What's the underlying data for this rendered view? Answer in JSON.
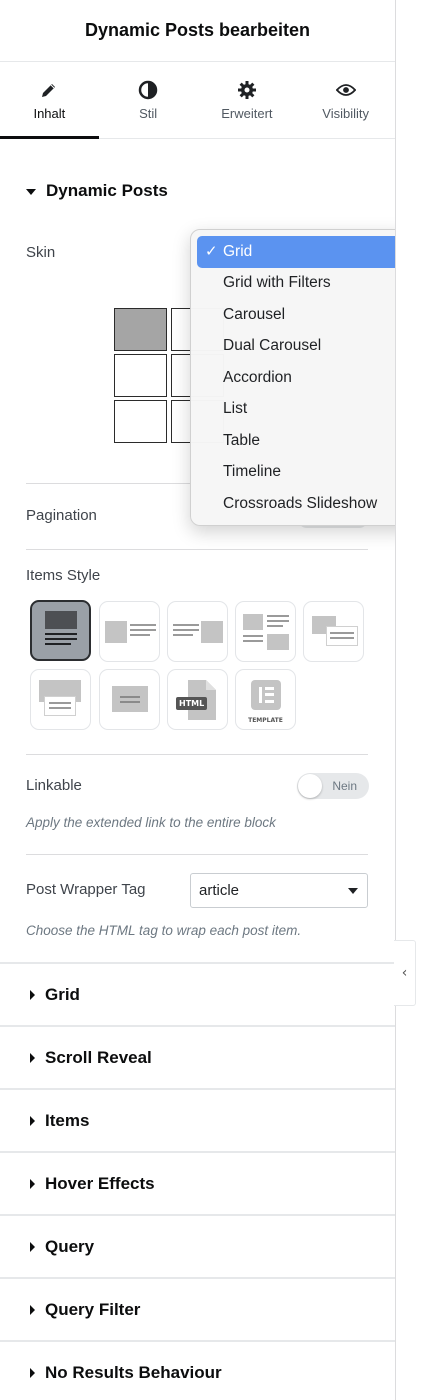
{
  "panel": {
    "title": "Dynamic Posts bearbeiten"
  },
  "tabs": [
    {
      "label": "Inhalt",
      "icon": "pencil-icon",
      "active": true
    },
    {
      "label": "Stil",
      "icon": "contrast-icon",
      "active": false
    },
    {
      "label": "Erweitert",
      "icon": "gear-icon",
      "active": false
    },
    {
      "label": "Visibility",
      "icon": "eye-icon",
      "active": false
    }
  ],
  "section_open": {
    "title": "Dynamic Posts"
  },
  "skin": {
    "label": "Skin",
    "dropdown": {
      "selected": "Grid",
      "check_mark": "✓",
      "options": [
        "Grid",
        "Grid with Filters",
        "Carousel",
        "Dual Carousel",
        "Accordion",
        "List",
        "Table",
        "Timeline",
        "Crossroads Slideshow"
      ]
    }
  },
  "pagination": {
    "label": "Pagination"
  },
  "items_style": {
    "label": "Items Style",
    "selected_index": 0,
    "html_badge": "HTML",
    "template_badge": "TEMPLATE"
  },
  "linkable": {
    "label": "Linkable",
    "toggle_text": "Nein",
    "toggle_on": false,
    "help": "Apply the extended link to the entire block"
  },
  "post_wrapper_tag": {
    "label": "Post Wrapper Tag",
    "value": "article",
    "help": "Choose the HTML tag to wrap each post item."
  },
  "collapsed_sections": [
    "Grid",
    "Scroll Reveal",
    "Items",
    "Hover Effects",
    "Query",
    "Query Filter",
    "No Results Behaviour"
  ],
  "colors": {
    "selection_blue": "#5b93f0",
    "active_tab_underline": "#0c0d0e"
  }
}
